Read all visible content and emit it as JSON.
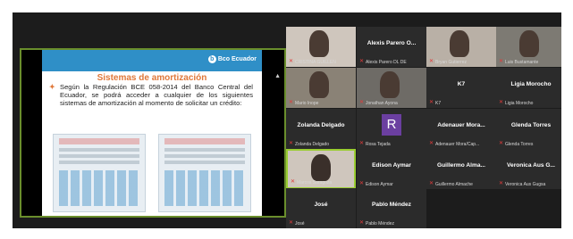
{
  "shared_screen": {
    "logo_text": "Bco Ecuador",
    "slide_title": "Sistemas de amortización",
    "slide_text": "Según la Regulación BCE 058-2014 del Banco Central del Ecuador, se podrá acceder a cualquier de los siguientes sistemas de amortización al momento de solicitar un crédito:",
    "bullet": "✦"
  },
  "participants": [
    {
      "name": "",
      "label": "CRISTINA GUILLEN",
      "video": true,
      "active": false
    },
    {
      "name": "Alexis Parero  O...",
      "label": "Alexis Parero  DL DE",
      "video": false,
      "active": false
    },
    {
      "name": "",
      "label": "Bryan Gutierrez",
      "video": true,
      "active": false
    },
    {
      "name": "",
      "label": "Luis Bustamante",
      "video": true,
      "active": false
    },
    {
      "name": "",
      "label": "Mario Inope",
      "video": true,
      "active": false
    },
    {
      "name": "",
      "label": "Jonathan Ayona",
      "video": true,
      "active": false
    },
    {
      "name": "K7",
      "label": "K7",
      "video": false,
      "active": false
    },
    {
      "name": "Ligia Morocho",
      "label": "Ligia Morocho",
      "video": false,
      "active": false
    },
    {
      "name": "Zolanda Delgado",
      "label": "Zolanda Delgado",
      "video": false,
      "active": false
    },
    {
      "name": "",
      "label": "Rosa Tejada",
      "video": false,
      "active": false,
      "avatar": "R"
    },
    {
      "name": "Adenauer  Mora...",
      "label": "Adenauer Mora/Cap...",
      "video": false,
      "active": false
    },
    {
      "name": "Glenda Torres",
      "label": "Glenda Torres",
      "video": false,
      "active": false
    },
    {
      "name": "",
      "label": "Marcos Saragoza",
      "video": true,
      "active": true
    },
    {
      "name": "Edison  Aymar",
      "label": "Edison Aymar",
      "video": false,
      "active": false
    },
    {
      "name": "Guillermo  Alma...",
      "label": "Guillermo Almache",
      "video": false,
      "active": false
    },
    {
      "name": "Veronica  Aus  G...",
      "label": "Veronica Aus Gugsa",
      "video": false,
      "active": false
    },
    {
      "name": "José",
      "label": "José",
      "video": false,
      "active": false
    },
    {
      "name": "Pablo Méndez",
      "label": "Pablo Méndez",
      "video": false,
      "active": false
    }
  ],
  "icons": {
    "mic_muted": "mic-off-icon"
  },
  "colors": {
    "active_border": "#9acd32",
    "muted": "#e23b3b",
    "tile_bg": "#2b2b2b"
  }
}
